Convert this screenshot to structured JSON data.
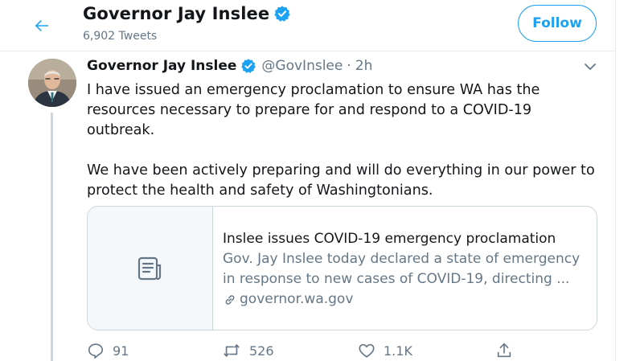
{
  "header": {
    "back_icon": "arrow-left-icon",
    "name": "Governor Jay Inslee",
    "verified_icon": "verified-badge-icon",
    "tweet_count": "6,902 Tweets",
    "follow_label": "Follow"
  },
  "tweet": {
    "author_name": "Governor Jay Inslee",
    "handle": "@GovInslee",
    "separator": "·",
    "time": "2h",
    "paragraphs": [
      "I have issued an emergency proclamation to ensure WA has the resources necessary to prepare for and respond to a COVID-19 outbreak.",
      "We have been actively preparing and will do everything in our power to protect the health and safety of Washingtonians."
    ],
    "card": {
      "thumb_icon": "document-icon",
      "title": "Inslee issues COVID-19 emergency proclamation",
      "description": "Gov. Jay Inslee today declared a state of emergency in response to new cases of COVID-19, directing ...",
      "link_icon": "link-icon",
      "domain": "governor.wa.gov"
    },
    "actions": {
      "reply_count": "91",
      "retweet_count": "526",
      "like_count": "1.1K"
    }
  },
  "colors": {
    "accent": "#1da1f2",
    "text_primary": "#14171a",
    "text_secondary": "#657786",
    "border": "#ccd6dd"
  }
}
